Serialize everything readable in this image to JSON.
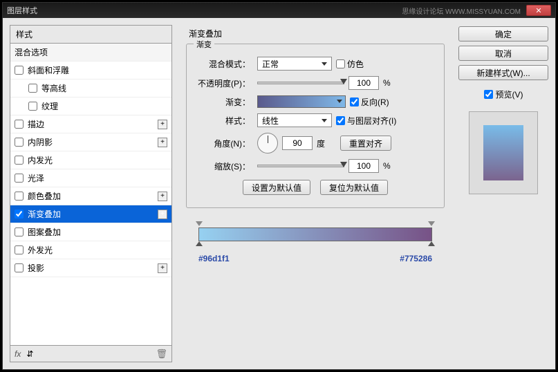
{
  "window": {
    "title": "图层样式",
    "watermark": "思缘设计论坛  WWW.MISSYUAN.COM"
  },
  "left": {
    "header": "样式",
    "blend_options": "混合选项",
    "items": [
      {
        "label": "斜面和浮雕",
        "checked": false,
        "plus": false,
        "indent": false
      },
      {
        "label": "等高线",
        "checked": false,
        "plus": false,
        "indent": true
      },
      {
        "label": "纹理",
        "checked": false,
        "plus": false,
        "indent": true
      },
      {
        "label": "描边",
        "checked": false,
        "plus": true,
        "indent": false
      },
      {
        "label": "内阴影",
        "checked": false,
        "plus": true,
        "indent": false
      },
      {
        "label": "内发光",
        "checked": false,
        "plus": false,
        "indent": false
      },
      {
        "label": "光泽",
        "checked": false,
        "plus": false,
        "indent": false
      },
      {
        "label": "颜色叠加",
        "checked": false,
        "plus": true,
        "indent": false
      },
      {
        "label": "渐变叠加",
        "checked": true,
        "plus": true,
        "indent": false,
        "selected": true
      },
      {
        "label": "图案叠加",
        "checked": false,
        "plus": false,
        "indent": false
      },
      {
        "label": "外发光",
        "checked": false,
        "plus": false,
        "indent": false
      },
      {
        "label": "投影",
        "checked": false,
        "plus": true,
        "indent": false
      }
    ],
    "footer_fx": "fx"
  },
  "center": {
    "section_title": "渐变叠加",
    "fieldset_legend": "渐变",
    "blend_mode_label": "混合模式：",
    "blend_mode_value": "正常",
    "dither_label": "仿色",
    "opacity_label": "不透明度(P)：",
    "opacity_value": "100",
    "pct": "%",
    "gradient_label": "渐变：",
    "reverse_label": "反向(R)",
    "style_label": "样式：",
    "style_value": "线性",
    "align_label": "与图层对齐(I)",
    "angle_label": "角度(N)：",
    "angle_value": "90",
    "angle_unit": "度",
    "reset_align": "重置对齐",
    "scale_label": "缩放(S)：",
    "scale_value": "100",
    "make_default": "设置为默认值",
    "reset_default": "复位为默认值",
    "color_left": "#96d1f1",
    "color_right": "#775286"
  },
  "right": {
    "ok": "确定",
    "cancel": "取消",
    "new_style": "新建样式(W)...",
    "preview_label": "预览(V)"
  },
  "chart_data": {
    "type": "gradient",
    "stops": [
      {
        "pos": 0,
        "color": "#96d1f1"
      },
      {
        "pos": 100,
        "color": "#775286"
      }
    ],
    "angle": 90,
    "opacity": 100,
    "scale": 100,
    "style": "线性",
    "blend": "正常",
    "reverse": true,
    "align": true
  }
}
